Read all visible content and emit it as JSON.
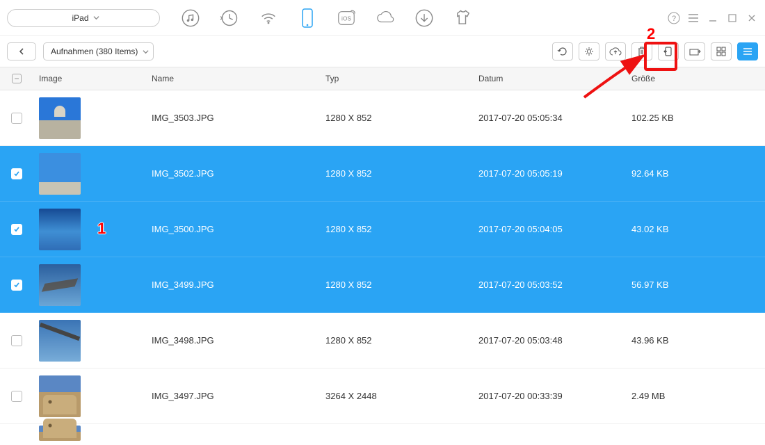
{
  "device": {
    "name": "iPad"
  },
  "breadcrumb": {
    "label": "Aufnahmen (380 Items)"
  },
  "columns": {
    "image": "Image",
    "name": "Name",
    "typ": "Typ",
    "datum": "Datum",
    "size": "Größe"
  },
  "annotations": {
    "callout1": "1",
    "callout2": "2"
  },
  "rows": [
    {
      "selected": false,
      "thumb": "th-basilica",
      "name": "IMG_3503.JPG",
      "typ": "1280 X 852",
      "datum": "2017-07-20 05:05:34",
      "size": "102.25 KB"
    },
    {
      "selected": true,
      "thumb": "th-plaza",
      "name": "IMG_3502.JPG",
      "typ": "1280 X 852",
      "datum": "2017-07-20 05:05:19",
      "size": "92.64 KB"
    },
    {
      "selected": true,
      "thumb": "th-horizon",
      "name": "IMG_3500.JPG",
      "typ": "1280 X 852",
      "datum": "2017-07-20 05:04:05",
      "size": "43.02 KB"
    },
    {
      "selected": true,
      "thumb": "th-island",
      "name": "IMG_3499.JPG",
      "typ": "1280 X 852",
      "datum": "2017-07-20 05:03:52",
      "size": "56.97 KB"
    },
    {
      "selected": false,
      "thumb": "th-wing",
      "name": "IMG_3498.JPG",
      "typ": "1280 X 852",
      "datum": "2017-07-20 05:03:48",
      "size": "43.96 KB"
    },
    {
      "selected": false,
      "thumb": "th-colosseum",
      "name": "IMG_3497.JPG",
      "typ": "3264 X 2448",
      "datum": "2017-07-20 00:33:39",
      "size": "2.49 MB"
    }
  ]
}
